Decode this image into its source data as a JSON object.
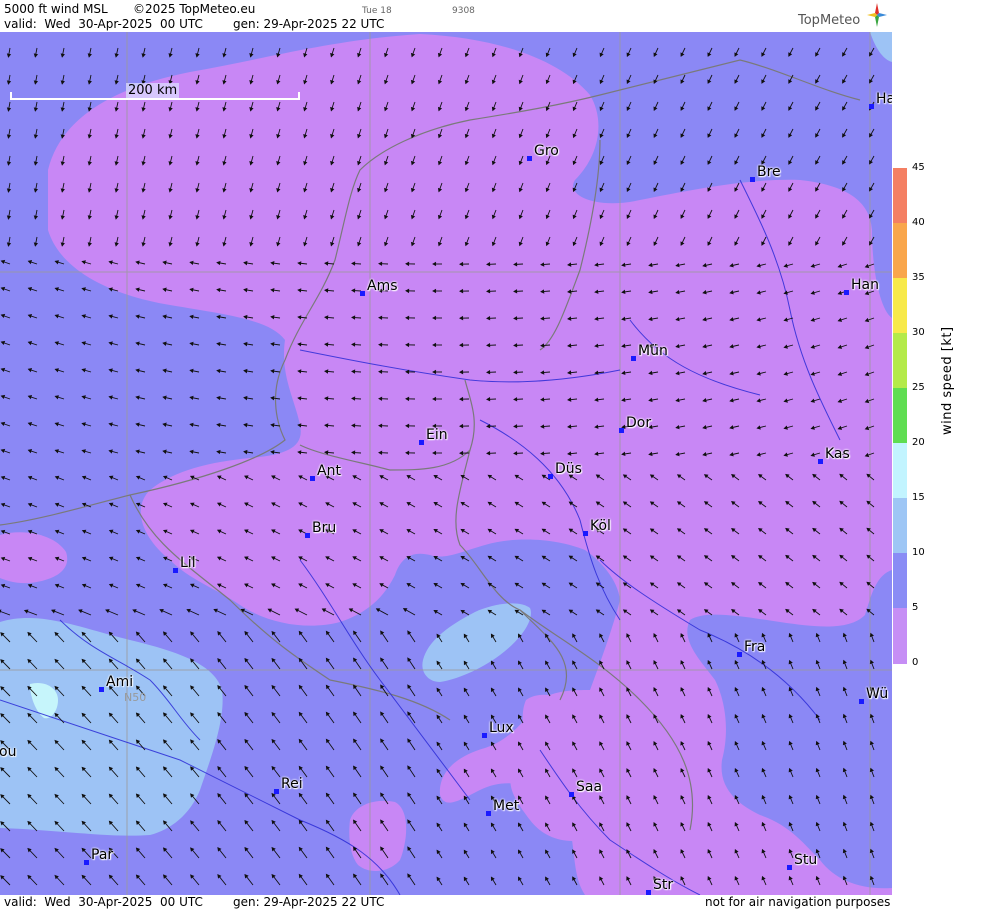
{
  "header": {
    "product": "5000 ft wind MSL",
    "copyright": "©2025 TopMeteo.eu",
    "valid": "valid:  Wed  30-Apr-2025  00 UTC",
    "generated": "gen: 29-Apr-2025 22 UTC",
    "faint_day": "Tue 18",
    "faint_code": "9308",
    "logo": "TopMeteo"
  },
  "footer": {
    "valid": "valid:  Wed  30-Apr-2025  00 UTC",
    "generated": "gen: 29-Apr-2025 22 UTC",
    "disclaimer": "not for air navigation purposes"
  },
  "scale": {
    "label": "200 km"
  },
  "grid_label": "N50",
  "colorbar": {
    "title": "wind  speed  [kt]",
    "ticks": [
      "45",
      "40",
      "35",
      "30",
      "25",
      "20",
      "15",
      "10",
      "5",
      "0"
    ],
    "colors": [
      "#f47f63",
      "#f7a150",
      "#f9c947",
      "#f7f24a",
      "#b4ea4a",
      "#5fdd52",
      "#74f0c8",
      "#c2f4ff",
      "#9ec6f5",
      "#8a8cf5",
      "#c68ef5"
    ]
  },
  "palette": {
    "calm": "#c887f5",
    "light": "#8b88f5",
    "moderate": "#9dc3f5",
    "strong": "#c6f5fb",
    "border": "#7a7a7a",
    "river": "#2b2bd6",
    "grid": "#9a9a9a"
  },
  "cities": [
    {
      "name": "Ha"
    },
    {
      "name": "Gro"
    },
    {
      "name": "Bre"
    },
    {
      "name": "Ams"
    },
    {
      "name": "Han"
    },
    {
      "name": "Mün"
    },
    {
      "name": "Ein"
    },
    {
      "name": "Dor"
    },
    {
      "name": "Ant"
    },
    {
      "name": "Düs"
    },
    {
      "name": "Kas"
    },
    {
      "name": "Bru"
    },
    {
      "name": "Köl"
    },
    {
      "name": "Lil"
    },
    {
      "name": "Fra"
    },
    {
      "name": "Ami"
    },
    {
      "name": "Wü"
    },
    {
      "name": "Lux"
    },
    {
      "name": "Rei"
    },
    {
      "name": "Saa"
    },
    {
      "name": "ou"
    },
    {
      "name": "Met"
    },
    {
      "name": "Par"
    },
    {
      "name": "Stu"
    },
    {
      "name": "Str"
    }
  ]
}
